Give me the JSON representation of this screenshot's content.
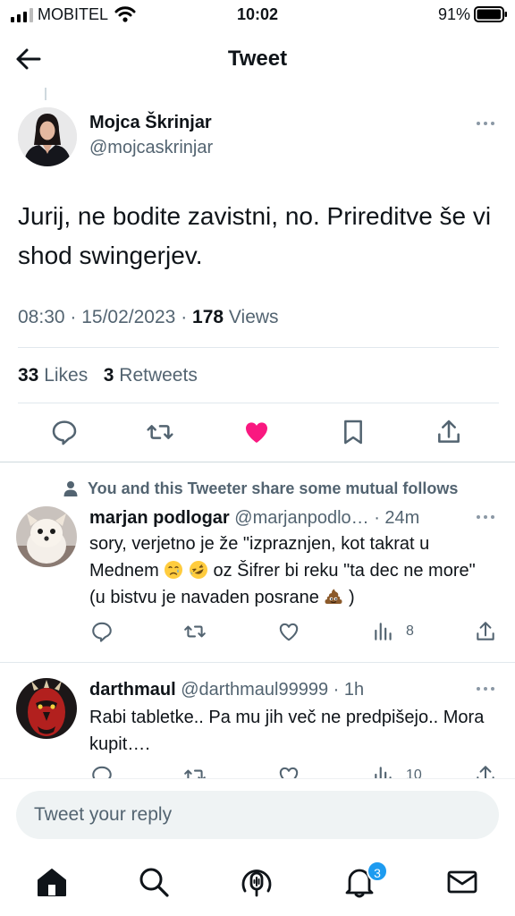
{
  "status_bar": {
    "carrier": "MOBITEL",
    "time": "10:02",
    "battery": "91%"
  },
  "header": {
    "title": "Tweet"
  },
  "tweet": {
    "author_name": "Mojca Škrinjar",
    "author_handle": "@mojcaskrinjar",
    "text": "Jurij, ne bodite zavistni, no. Prireditve še vi shod swingerjev.",
    "time": "08:30",
    "date": "15/02/2023",
    "views": "178",
    "views_label": "Views",
    "likes": "33",
    "likes_label": "Likes",
    "retweets": "3",
    "retweets_label": "Retweets",
    "liked": true
  },
  "mutual_note": "You and this Tweeter share some mutual follows",
  "replies": [
    {
      "name": "marjan podlogar",
      "handle": "@marjanpodlo…",
      "age": "· 24m",
      "text_1": "sory, verjetno je že \"izpraznjen, kot takrat u Mednem",
      "text_2": "oz Šifrer bi reku \"ta dec ne more\"(u bistvu je navaden posrane",
      "text_3": ")",
      "views": "8"
    },
    {
      "name": "darthmaul",
      "handle": "@darthmaul99999",
      "age": "· 1h",
      "text": "Rabi tabletke.. Pa mu jih več ne predpišejo.. Mora kupit….",
      "views": "10"
    }
  ],
  "compose": {
    "placeholder": "Tweet your reply"
  },
  "nav": {
    "notifications_badge": "3"
  },
  "colors": {
    "like": "#f91880",
    "accent": "#1d9bf0",
    "text": "#0f1419",
    "muted": "#536471"
  }
}
